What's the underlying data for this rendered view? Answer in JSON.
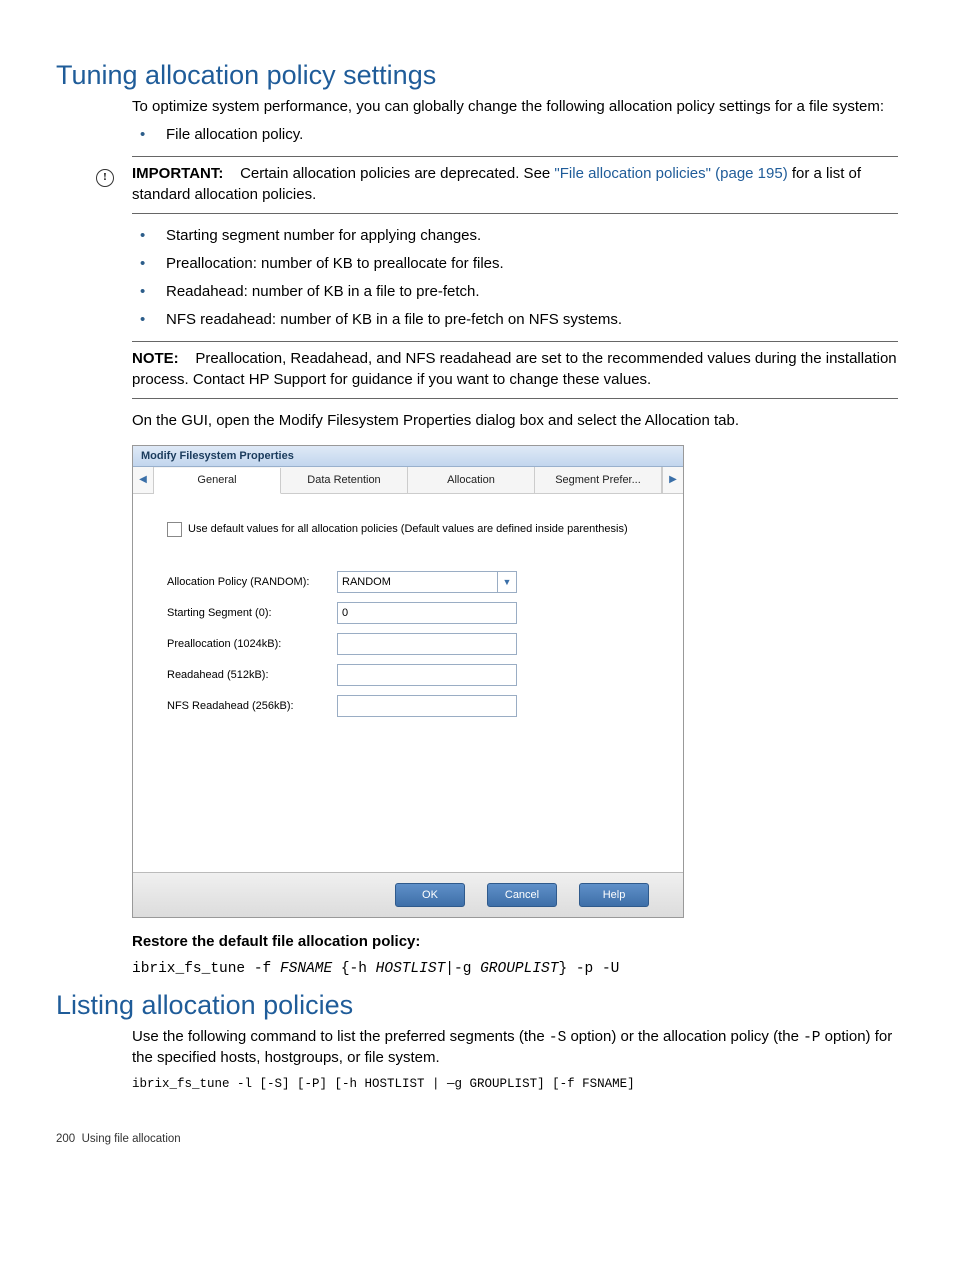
{
  "sec1": {
    "title": "Tuning allocation policy settings",
    "intro": "To optimize system performance, you can globally change the following allocation policy settings for a file system:",
    "bullets_pre": [
      "File allocation policy."
    ],
    "important": {
      "label": "IMPORTANT:",
      "text1": "Certain allocation policies are deprecated. See ",
      "link": "\"File allocation policies\" (page 195)",
      "text2": " for a list of standard allocation policies."
    },
    "bullets_post": [
      "Starting segment number for applying changes.",
      "Preallocation: number of KB to preallocate for files.",
      "Readahead: number of KB in a file to pre-fetch.",
      "NFS readahead: number of KB in a file to pre-fetch on NFS systems."
    ],
    "note": {
      "label": "NOTE:",
      "text": "Preallocation, Readahead, and NFS readahead are set to the recommended values during the installation process. Contact HP Support for guidance if you want to change these values."
    },
    "gui_text": "On the GUI, open the Modify Filesystem Properties dialog box and select the Allocation tab.",
    "restore_heading": "Restore the default file allocation policy:",
    "restore_cmd_parts": {
      "p1": "ibrix_fs_tune -f ",
      "v1": "FSNAME",
      "p2": " {-h ",
      "v2": "HOSTLIST",
      "p3": "|-g ",
      "v3": "GROUPLIST",
      "p4": "} -p -U"
    }
  },
  "dialog": {
    "title": "Modify Filesystem Properties",
    "tabs": [
      "General",
      "Data Retention",
      "Allocation",
      "Segment Prefer..."
    ],
    "checkbox_label": "Use default values for all allocation policies (Default values are defined inside parenthesis)",
    "rows": [
      {
        "label": "Allocation Policy (RANDOM):",
        "value": "RANDOM",
        "dropdown": true
      },
      {
        "label": "Starting Segment (0):",
        "value": "0",
        "dropdown": false
      },
      {
        "label": "Preallocation (1024kB):",
        "value": "",
        "dropdown": false
      },
      {
        "label": "Readahead (512kB):",
        "value": "",
        "dropdown": false
      },
      {
        "label": "NFS Readahead (256kB):",
        "value": "",
        "dropdown": false
      }
    ],
    "buttons": {
      "ok": "OK",
      "cancel": "Cancel",
      "help": "Help"
    }
  },
  "sec2": {
    "title": "Listing allocation policies",
    "intro_p1": "Use the following command to list the preferred segments (the ",
    "opt1": "-S",
    "intro_p2": " option) or the allocation policy (the ",
    "opt2": "-P",
    "intro_p3": " option) for the specified hosts, hostgroups, or file system.",
    "cmd": "ibrix_fs_tune -l [-S] [-P] [-h HOSTLIST | —g GROUPLIST] [-f FSNAME]"
  },
  "footer": {
    "page_num": "200",
    "chapter": "Using file allocation"
  }
}
